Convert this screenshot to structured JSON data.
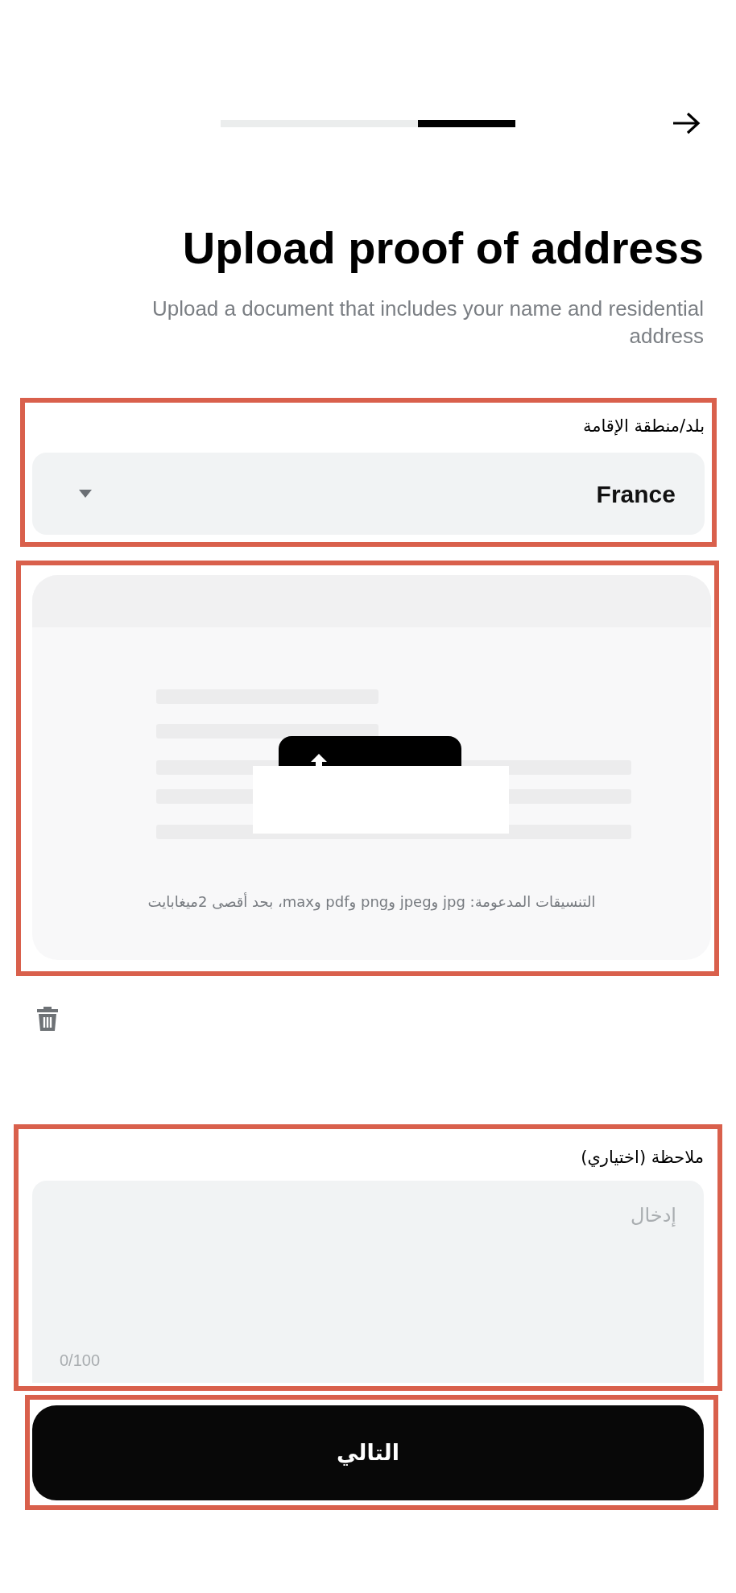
{
  "progress": {
    "level": 0.33
  },
  "title": "Upload proof of address",
  "subtitle": "Upload a document that includes your name and residential address",
  "country_field": {
    "label": "بلد/منطقة الإقامة",
    "value": "France"
  },
  "upload": {
    "formats_note": "التنسيقات المدعومة: jpg وjpeg وpng وpdf وmax، بحد أقصى 2ميغابايت"
  },
  "note_field": {
    "label": "ملاحظة (اختياري)",
    "placeholder": "إدخال",
    "counter": "0/100"
  },
  "next_button": "التالي"
}
